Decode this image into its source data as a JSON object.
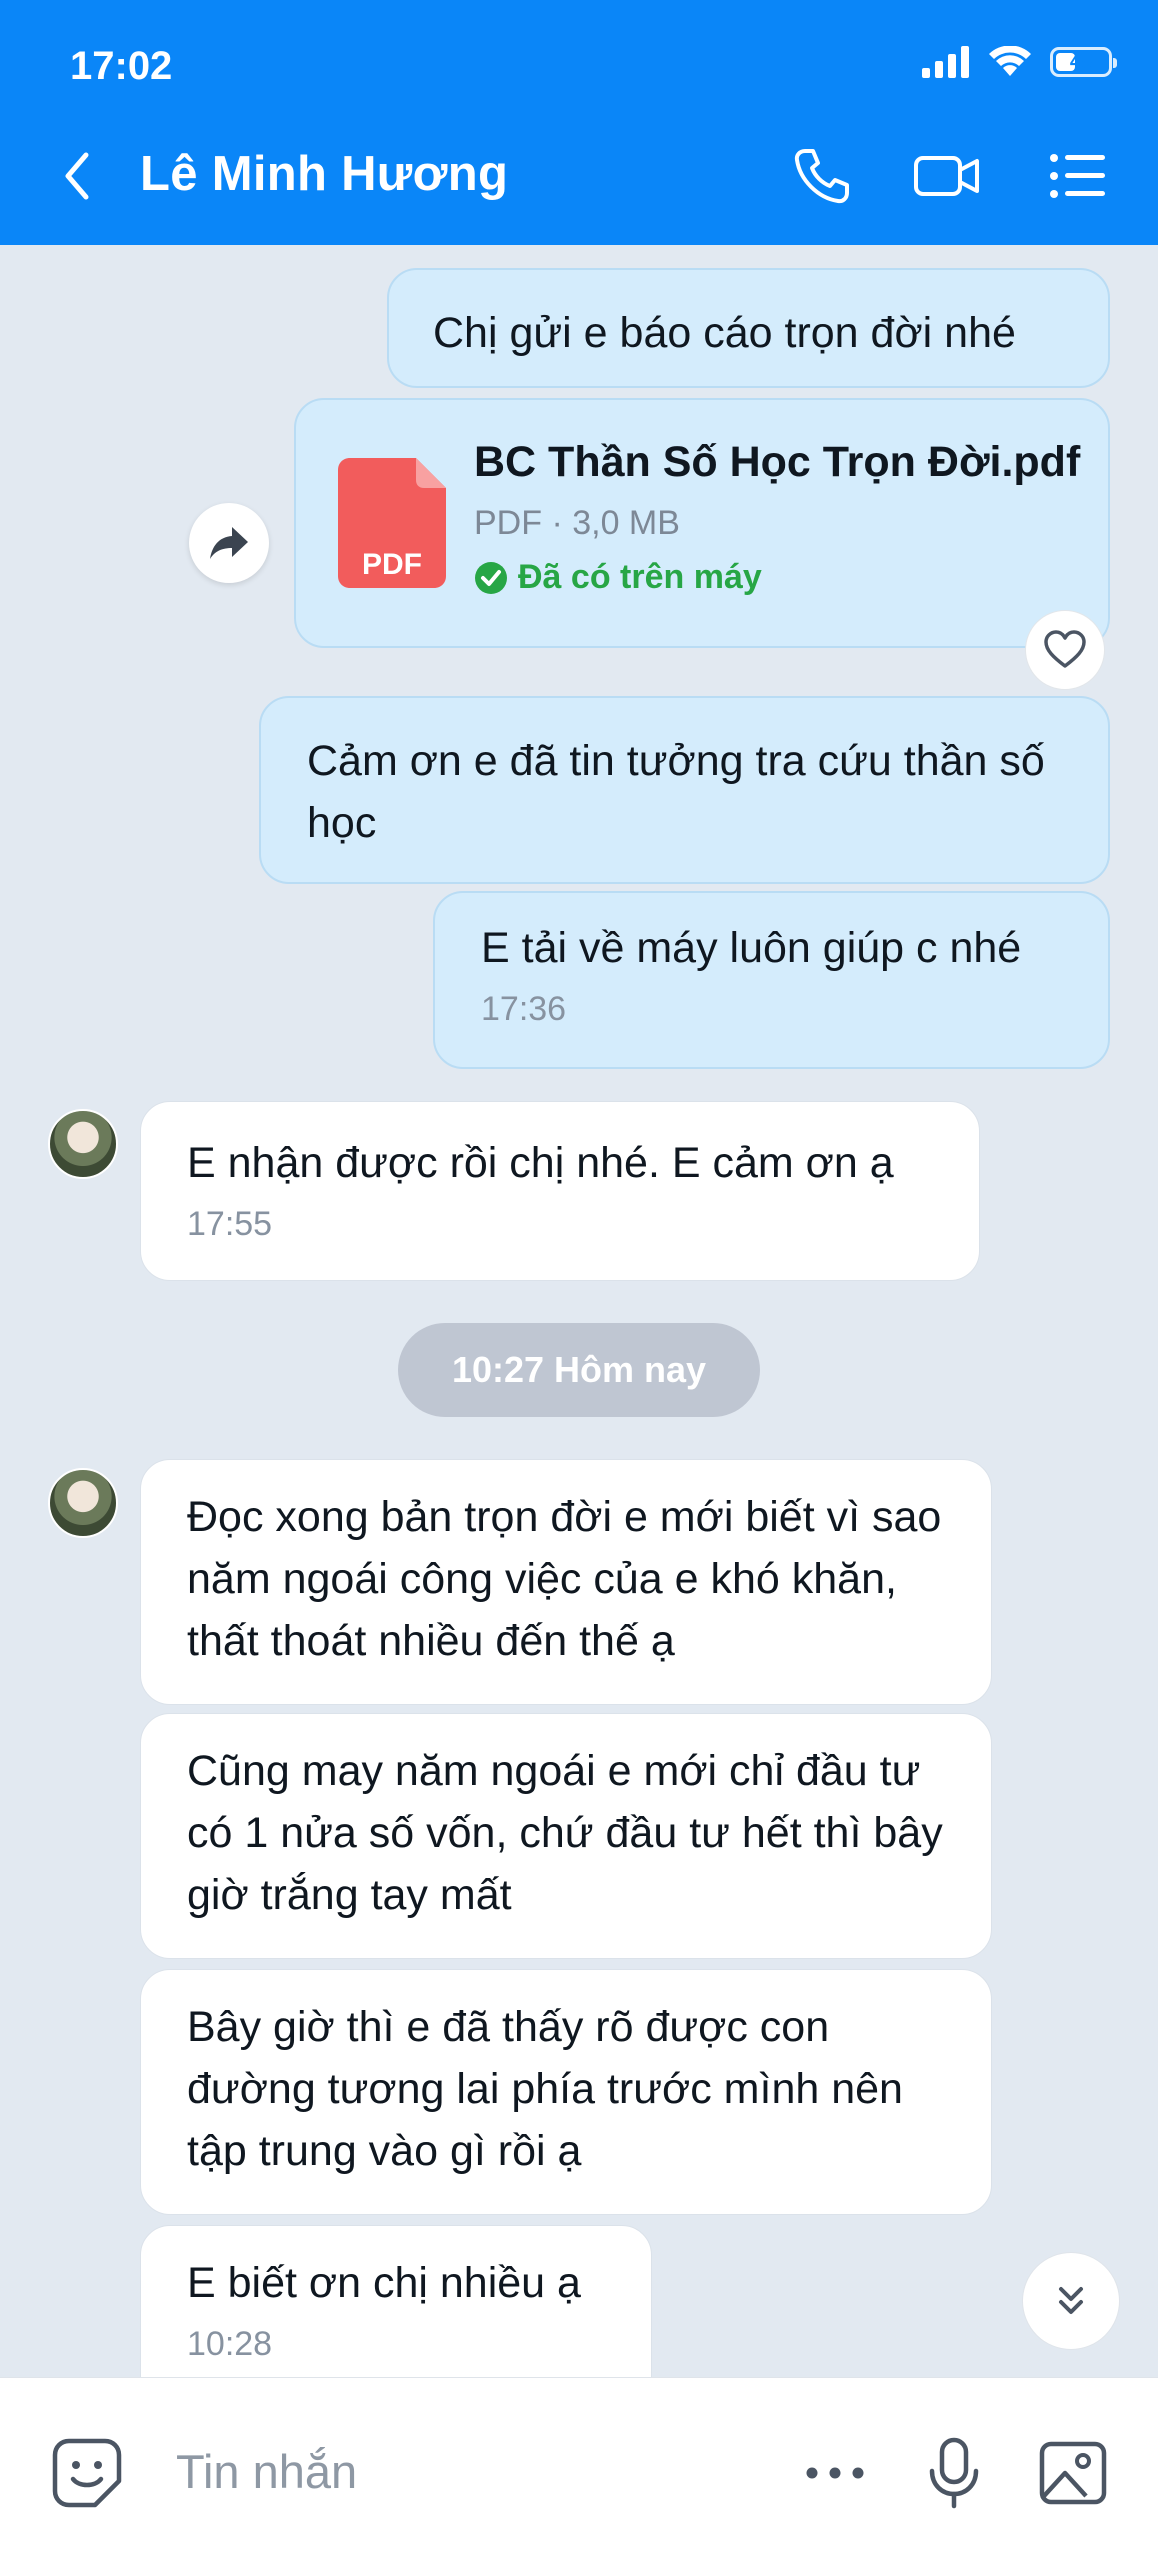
{
  "status_bar": {
    "time": "17:02",
    "battery": "45",
    "battery_level": 0.45
  },
  "header": {
    "contact_name": "Lê Minh Hương"
  },
  "messages": [
    {
      "from": "me",
      "text": "Chị gửi e báo cáo trọn đời nhé"
    },
    {
      "from": "me",
      "type": "file",
      "file_name": "BC Thần Số Học Trọn Đời.pdf",
      "file_meta": "PDF · 3,0 MB",
      "file_status": "Đã có trên máy",
      "file_type_label": "PDF"
    },
    {
      "from": "me",
      "text": "Cảm ơn e đã tin tưởng tra cứu thần số học"
    },
    {
      "from": "me",
      "text": "E tải về máy luôn giúp c nhé",
      "time": "17:36"
    },
    {
      "from": "them",
      "text": "E nhận được rồi chị nhé. E cảm ơn ạ",
      "time": "17:55"
    },
    {
      "from": "them",
      "text": "Đọc xong bản trọn đời e mới biết vì sao năm ngoái công việc của e khó khăn, thất thoát nhiều đến thế ạ"
    },
    {
      "from": "them",
      "text": "Cũng may năm ngoái e mới chỉ đầu tư có 1 nửa số vốn, chứ đầu tư hết thì bây giờ trắng tay mất"
    },
    {
      "from": "them",
      "text": "Bây giờ thì e đã thấy rõ được con đường tương lai phía trước mình nên tập trung vào gì rồi ạ"
    },
    {
      "from": "them",
      "text": "E biết ơn chị nhiều ạ",
      "time": "10:28"
    }
  ],
  "date_separator": "10:27 Hôm nay",
  "input": {
    "placeholder": "Tin nhắn"
  },
  "icons": {
    "back": "chevron-left-icon",
    "call": "phone-icon",
    "video": "video-camera-icon",
    "menu": "list-menu-icon",
    "share": "share-forward-icon",
    "like": "heart-icon",
    "scroll": "double-chevron-down-icon",
    "sticker": "sticker-icon",
    "more": "more-dots-icon",
    "mic": "microphone-icon",
    "image": "image-icon"
  },
  "colors": {
    "header": "#0a86f8",
    "my_bubble": "#d4ecfc",
    "their_bubble": "#ffffff",
    "chat_background": "#e2e9f1",
    "downloaded_status": "#27a645",
    "pdf": "#f25c5c"
  }
}
